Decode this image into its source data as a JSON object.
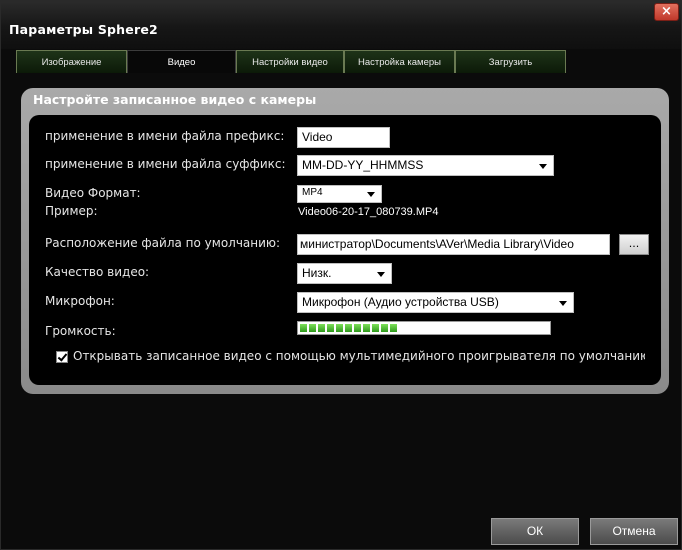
{
  "window": {
    "title": "Параметры Sphere2",
    "close_label": "×"
  },
  "tabs": [
    {
      "label": "Изображение"
    },
    {
      "label": "Видео"
    },
    {
      "label": "Настройки видео"
    },
    {
      "label": "Настройка камеры"
    },
    {
      "label": "Загрузить"
    }
  ],
  "active_tab": "Видео",
  "panel": {
    "title": "Настройте записанное видео с камеры",
    "prefix_label": "применение в имени файла префикс:",
    "prefix_value": "Video",
    "suffix_label": "применение в имени файла суффикс:",
    "suffix_value": "MM-DD-YY_HHMMSS",
    "format_label": "Видео Формат:",
    "format_value": "MP4",
    "example_label": "Пример:",
    "example_value": "Video06-20-17_080739.MP4",
    "location_label": "Расположение файла по умолчанию:",
    "location_value": "министратор\\Documents\\AVer\\Media Library\\Video",
    "browse_label": "...",
    "quality_label": "Качество видео:",
    "quality_value": "Низк.",
    "mic_label": "Микрофон:",
    "mic_value": "Микрофон (Аудио устройства USB)",
    "volume_label": "Громкость:",
    "volume_level": 0.39,
    "open_with_player_label": "Открывать записанное видео с помощью мультимедийного проигрывателя по умолчанию",
    "open_with_player_checked": true
  },
  "buttons": {
    "ok": "ОК",
    "cancel": "Отмена"
  },
  "colors": {
    "tab_green": "#1e3318",
    "panel_gray": "#9a9a9a",
    "volume_green": "#2f9a1c",
    "close_red": "#c0382a"
  }
}
